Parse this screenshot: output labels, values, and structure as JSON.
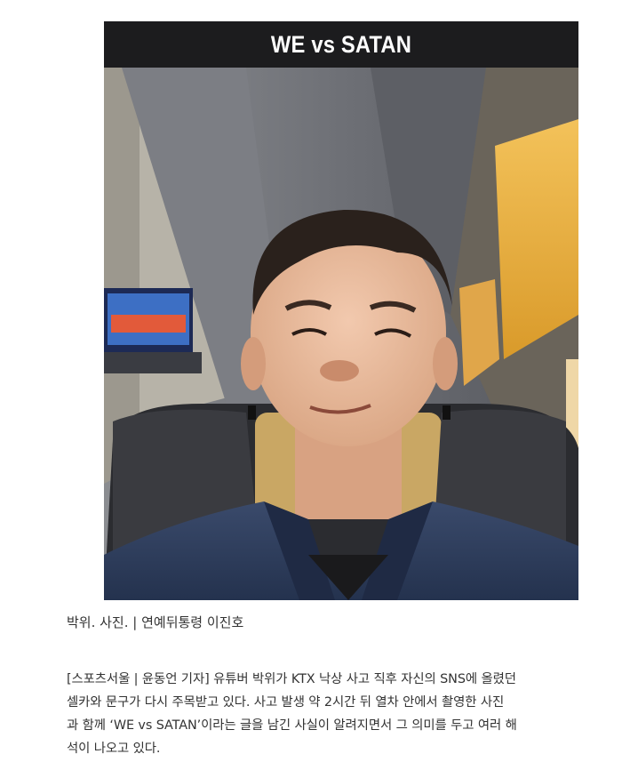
{
  "photo": {
    "overlay_title": "WE vs SATAN"
  },
  "caption": "박위. 사진. | 연예뒤통령 이진호",
  "article": {
    "lines": [
      "[스포츠서울 | 윤동언 기자] 유튜버 박위가 KTX 낙상 사고 직후 자신의 SNS에 올렸던",
      "셀카와 문구가 다시 주목받고 있다. 사고 발생 약 2시간 뒤 열차 안에서 촬영한 사진",
      "과 함께 ‘WE vs SATAN’이라는 글을 남긴 사실이 알려지면서 그 의미를 두고 여러 해",
      "석이 나오고 있다."
    ]
  }
}
